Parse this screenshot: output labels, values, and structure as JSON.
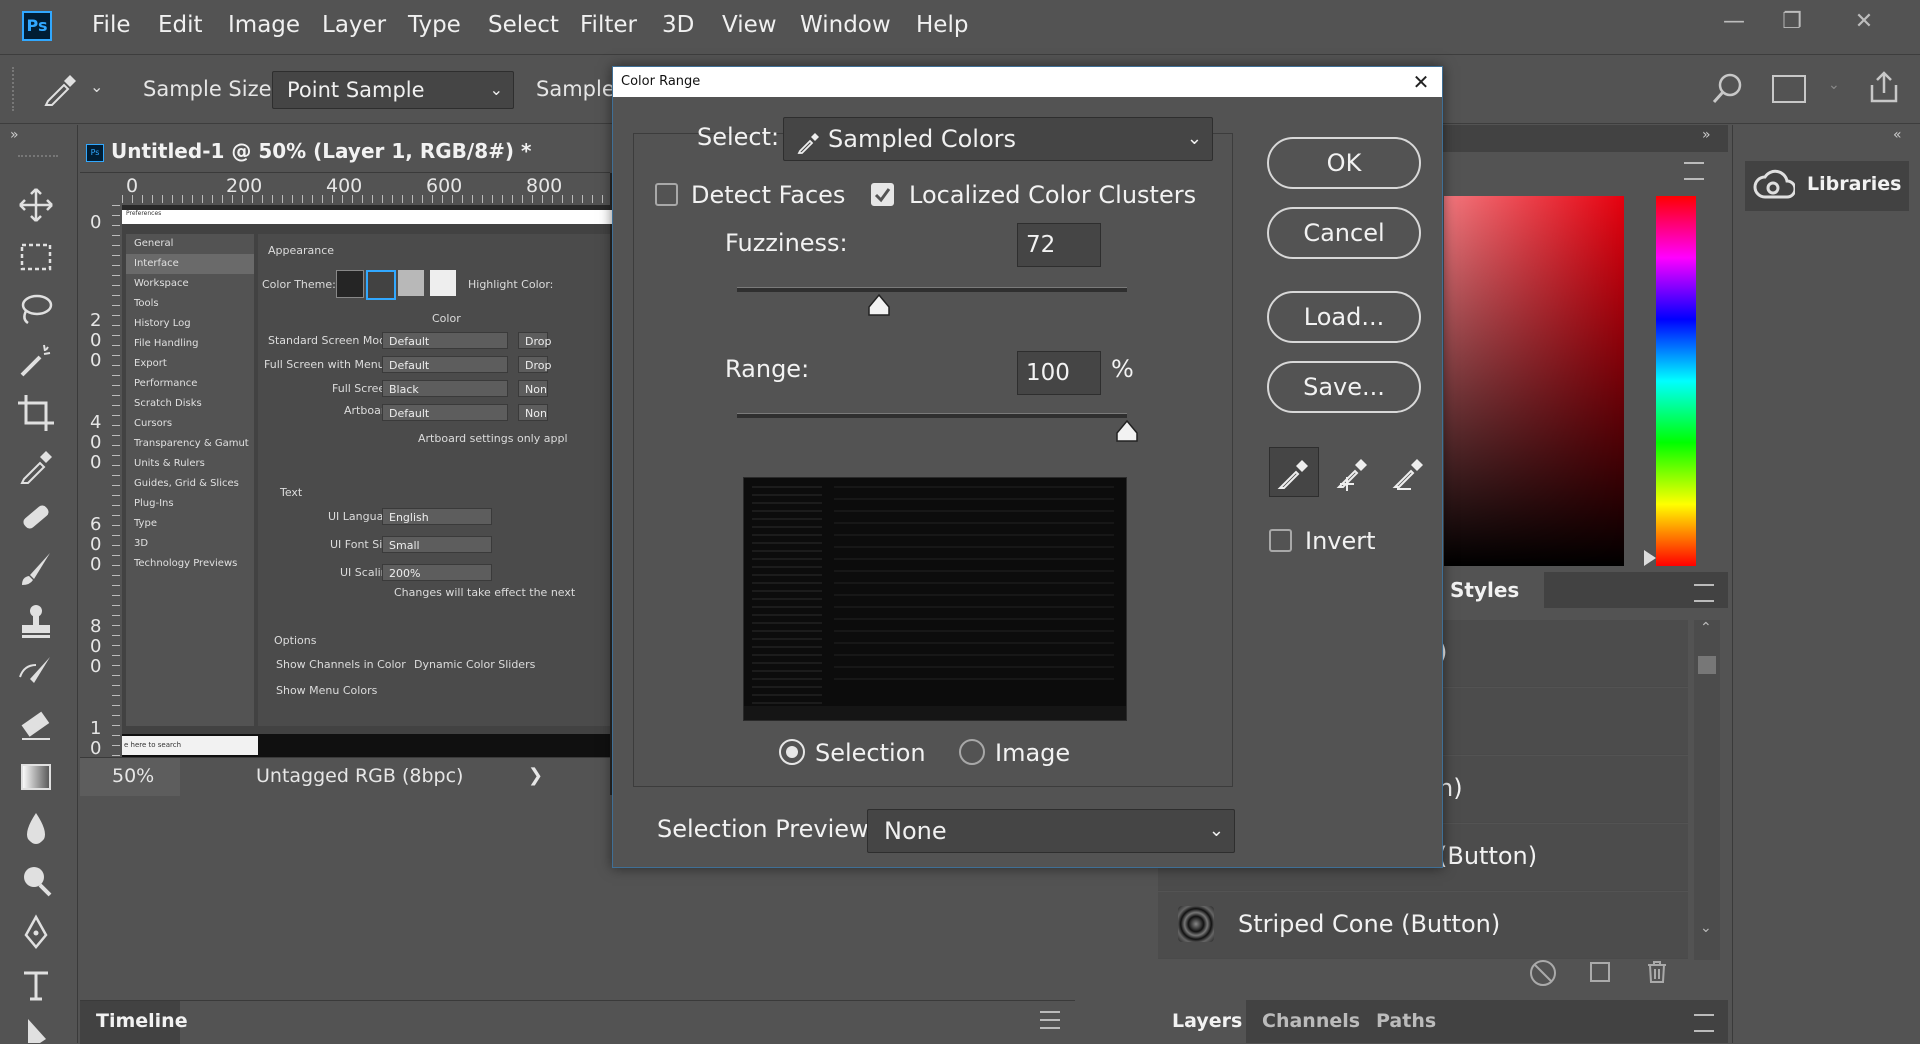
{
  "menubar": {
    "app_logo": "Ps",
    "items": [
      "File",
      "Edit",
      "Image",
      "Layer",
      "Type",
      "Select",
      "Filter",
      "3D",
      "View",
      "Window",
      "Help"
    ]
  },
  "options_bar": {
    "sample_size_label": "Sample Size:",
    "sample_size_value": "Point Sample",
    "sample_label": "Sample:"
  },
  "document": {
    "tab_title": "Untitled-1 @ 50% (Layer 1, RGB/8#) *",
    "ruler_top": [
      "0",
      "200",
      "400",
      "600",
      "800"
    ],
    "ruler_left": [
      "0",
      "2\n0\n0",
      "4\n0\n0",
      "6\n0\n0",
      "8\n0\n0",
      "1\n0"
    ],
    "zoom": "50%",
    "color_profile": "Untagged RGB (8bpc)",
    "status_arrow": "❯"
  },
  "canvas_prefs": {
    "title": "Preferences",
    "sidebar": [
      "General",
      "Interface",
      "Workspace",
      "Tools",
      "History Log",
      "File Handling",
      "Export",
      "Performance",
      "Scratch Disks",
      "Cursors",
      "Transparency & Gamut",
      "Units & Rulers",
      "Guides, Grid & Slices",
      "Plug-Ins",
      "Type",
      "3D",
      "Technology Previews"
    ],
    "appearance": "Appearance",
    "color_theme": "Color Theme:",
    "highlight_color": "Highlight Color:",
    "color": "Color",
    "standard_screen_mode": "Standard Screen Mode:",
    "full_screen_menus": "Full Screen with Menus:",
    "full_screen": "Full Screen:",
    "artboards": "Artboards:",
    "dd_default": "Default",
    "dd_black": "Black",
    "drop1": "Drop",
    "drop2": "Drop",
    "none1": "Non",
    "none2": "Non",
    "artboard_info": "Artboard settings only appl",
    "text_section": "Text",
    "ui_language": "UI Language:",
    "ui_language_val": "English",
    "ui_font_size": "UI Font Size:",
    "ui_font_size_val": "Small",
    "ui_scaling": "UI Scaling:",
    "ui_scaling_val": "200%",
    "changes_info": "Changes will take effect the next",
    "options": "Options",
    "show_channels": "Show Channels in Color",
    "dynamic_sliders": "Dynamic Color Sliders",
    "show_menu_colors": "Show Menu Colors",
    "taskbar_search": "e here to search"
  },
  "timeline": {
    "label": "Timeline"
  },
  "right_panels": {
    "styles_tab": "Styles",
    "style_rows": [
      ")",
      "",
      "n)",
      "(Button)",
      "Striped Cone (Button)"
    ],
    "layers_tabs": [
      "Layers",
      "Channels",
      "Paths"
    ],
    "libraries": "Libraries"
  },
  "dialog": {
    "title": "Color Range",
    "select_label": "Select:",
    "select_value": "Sampled Colors",
    "detect_faces": "Detect Faces",
    "detect_faces_checked": false,
    "localized_clusters": "Localized Color Clusters",
    "localized_clusters_checked": true,
    "fuzziness_label": "Fuzziness:",
    "fuzziness_value": "72",
    "range_label": "Range:",
    "range_value": "100",
    "range_unit": "%",
    "selection_radio": "Selection",
    "image_radio": "Image",
    "selection_preview_label": "Selection Preview:",
    "selection_preview_value": "None",
    "ok": "OK",
    "cancel": "Cancel",
    "load": "Load...",
    "save": "Save...",
    "invert": "Invert",
    "invert_checked": false
  },
  "colors": {
    "ui_bg": "#535353",
    "dark_bg": "#282828",
    "accent": "#31a8ff"
  }
}
